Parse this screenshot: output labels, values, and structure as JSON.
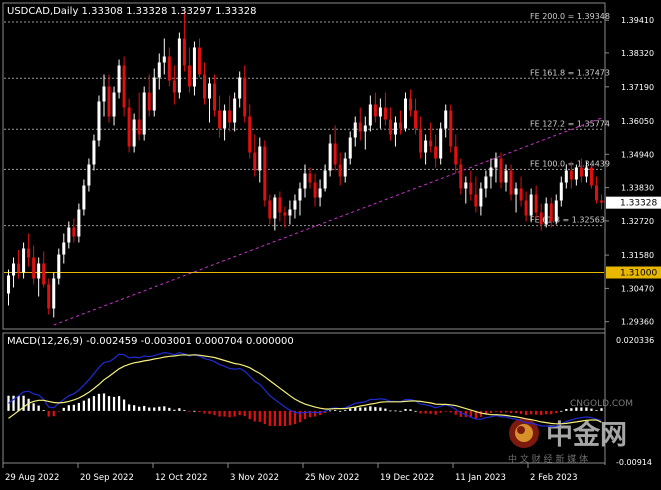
{
  "header": {
    "symbol_line": "USDCAD,Daily  1.33308 1.33328 1.33297 1.33328"
  },
  "macd_header": "MACD(12,26,9) -0.002459 -0.003001 0.000704 0.000000",
  "price_axis": {
    "ticks": [
      "1.39410",
      "1.38320",
      "1.37190",
      "1.36050",
      "1.34940",
      "1.33830",
      "1.32720",
      "1.31580",
      "1.30470",
      "1.29360"
    ],
    "current_price_tag": "1.33328",
    "level_tag": "1.31000"
  },
  "macd_axis": {
    "ticks": [
      "0.020336",
      "-0.00914"
    ]
  },
  "date_axis": {
    "ticks": [
      "29 Aug 2022",
      "20 Sep 2022",
      "12 Oct 2022",
      "3 Nov 2022",
      "25 Nov 2022",
      "19 Dec 2022",
      "11 Jan 2023",
      "2 Feb 2023"
    ]
  },
  "fib_levels": [
    {
      "label": "FE 200.0 = 1.39348",
      "value": 1.39348
    },
    {
      "label": "FE 161.8 = 1.37473",
      "value": 1.37473
    },
    {
      "label": "FE 127.2 = 1.35774",
      "value": 1.35774
    },
    {
      "label": "FE 100.0 = 1.34439",
      "value": 1.34439
    },
    {
      "label": "FE 61.8 = 1.32563",
      "value": 1.32563
    }
  ],
  "watermark": {
    "brand_cn": "中金网",
    "domain": "CNGOLD.COM",
    "tagline": "中 文 财 经 新 媒 体"
  },
  "colors": {
    "background": "#000000",
    "bull_candle": "#ffffff",
    "bear_candle": "#e01010",
    "fib_line": "#9a9a9a",
    "trendline": "#cc33cc",
    "level_line": "#e8b800",
    "macd_line": "#1f2bd6",
    "signal_line": "#f2f07a",
    "hist_up": "#ffffff",
    "hist_down": "#e01010"
  },
  "chart_data": {
    "type": "candlestick",
    "symbol": "USDCAD",
    "timeframe": "Daily",
    "ylim": [
      1.2915,
      1.3995
    ],
    "horizontal_level": 1.31,
    "last_price": 1.33328,
    "trendline": {
      "from": {
        "bar": 9,
        "price": 1.2925
      },
      "to": {
        "bar": 118,
        "price": 1.3615
      }
    },
    "candles": [
      [
        1.303,
        1.311,
        1.299,
        1.309
      ],
      [
        1.309,
        1.315,
        1.305,
        1.313
      ],
      [
        1.313,
        1.3175,
        1.308,
        1.31
      ],
      [
        1.31,
        1.32,
        1.308,
        1.318
      ],
      [
        1.318,
        1.323,
        1.312,
        1.315
      ],
      [
        1.315,
        1.319,
        1.306,
        1.308
      ],
      [
        1.308,
        1.315,
        1.302,
        1.313
      ],
      [
        1.313,
        1.317,
        1.305,
        1.306
      ],
      [
        1.306,
        1.308,
        1.296,
        1.298
      ],
      [
        1.298,
        1.31,
        1.295,
        1.308
      ],
      [
        1.308,
        1.318,
        1.306,
        1.316
      ],
      [
        1.316,
        1.323,
        1.313,
        1.32
      ],
      [
        1.32,
        1.327,
        1.318,
        1.325
      ],
      [
        1.325,
        1.328,
        1.32,
        1.322
      ],
      [
        1.322,
        1.333,
        1.32,
        1.331
      ],
      [
        1.331,
        1.341,
        1.329,
        1.339
      ],
      [
        1.339,
        1.348,
        1.337,
        1.346
      ],
      [
        1.346,
        1.356,
        1.344,
        1.354
      ],
      [
        1.354,
        1.369,
        1.352,
        1.367
      ],
      [
        1.367,
        1.376,
        1.362,
        1.372
      ],
      [
        1.372,
        1.376,
        1.36,
        1.362
      ],
      [
        1.362,
        1.372,
        1.359,
        1.37
      ],
      [
        1.37,
        1.381,
        1.368,
        1.379
      ],
      [
        1.379,
        1.382,
        1.362,
        1.365
      ],
      [
        1.365,
        1.368,
        1.35,
        1.352
      ],
      [
        1.352,
        1.363,
        1.35,
        1.361
      ],
      [
        1.361,
        1.37,
        1.354,
        1.356
      ],
      [
        1.356,
        1.372,
        1.354,
        1.37
      ],
      [
        1.37,
        1.376,
        1.362,
        1.364
      ],
      [
        1.364,
        1.378,
        1.362,
        1.375
      ],
      [
        1.375,
        1.383,
        1.371,
        1.38
      ],
      [
        1.38,
        1.388,
        1.376,
        1.382
      ],
      [
        1.382,
        1.385,
        1.372,
        1.374
      ],
      [
        1.374,
        1.379,
        1.366,
        1.37
      ],
      [
        1.37,
        1.39,
        1.368,
        1.388
      ],
      [
        1.388,
        1.397,
        1.377,
        1.379
      ],
      [
        1.379,
        1.385,
        1.37,
        1.372
      ],
      [
        1.372,
        1.387,
        1.369,
        1.385
      ],
      [
        1.385,
        1.388,
        1.375,
        1.376
      ],
      [
        1.376,
        1.38,
        1.366,
        1.368
      ],
      [
        1.368,
        1.375,
        1.36,
        1.373
      ],
      [
        1.373,
        1.376,
        1.362,
        1.364
      ],
      [
        1.364,
        1.369,
        1.355,
        1.358
      ],
      [
        1.358,
        1.366,
        1.354,
        1.364
      ],
      [
        1.364,
        1.369,
        1.357,
        1.36
      ],
      [
        1.36,
        1.37,
        1.357,
        1.368
      ],
      [
        1.368,
        1.377,
        1.365,
        1.375
      ],
      [
        1.375,
        1.379,
        1.36,
        1.362
      ],
      [
        1.362,
        1.366,
        1.348,
        1.35
      ],
      [
        1.35,
        1.356,
        1.342,
        1.344
      ],
      [
        1.344,
        1.355,
        1.34,
        1.352
      ],
      [
        1.352,
        1.354,
        1.332,
        1.334
      ],
      [
        1.334,
        1.336,
        1.326,
        1.328
      ],
      [
        1.328,
        1.336,
        1.324,
        1.335
      ],
      [
        1.335,
        1.337,
        1.327,
        1.33
      ],
      [
        1.33,
        1.332,
        1.325,
        1.329
      ],
      [
        1.329,
        1.334,
        1.326,
        1.331
      ],
      [
        1.331,
        1.336,
        1.328,
        1.334
      ],
      [
        1.334,
        1.34,
        1.329,
        1.338
      ],
      [
        1.338,
        1.346,
        1.335,
        1.343
      ],
      [
        1.343,
        1.345,
        1.338,
        1.34
      ],
      [
        1.34,
        1.343,
        1.332,
        1.335
      ],
      [
        1.335,
        1.341,
        1.332,
        1.338
      ],
      [
        1.338,
        1.346,
        1.337,
        1.344
      ],
      [
        1.344,
        1.356,
        1.342,
        1.353
      ],
      [
        1.353,
        1.359,
        1.344,
        1.346
      ],
      [
        1.346,
        1.35,
        1.339,
        1.342
      ],
      [
        1.342,
        1.35,
        1.34,
        1.348
      ],
      [
        1.348,
        1.357,
        1.346,
        1.355
      ],
      [
        1.355,
        1.362,
        1.352,
        1.36
      ],
      [
        1.36,
        1.365,
        1.354,
        1.357
      ],
      [
        1.357,
        1.362,
        1.351,
        1.359
      ],
      [
        1.359,
        1.369,
        1.357,
        1.366
      ],
      [
        1.366,
        1.37,
        1.36,
        1.362
      ],
      [
        1.362,
        1.368,
        1.358,
        1.365
      ],
      [
        1.365,
        1.37,
        1.359,
        1.361
      ],
      [
        1.361,
        1.365,
        1.354,
        1.356
      ],
      [
        1.356,
        1.362,
        1.352,
        1.36
      ],
      [
        1.36,
        1.364,
        1.356,
        1.358
      ],
      [
        1.358,
        1.37,
        1.357,
        1.368
      ],
      [
        1.368,
        1.371,
        1.362,
        1.364
      ],
      [
        1.364,
        1.368,
        1.356,
        1.358
      ],
      [
        1.358,
        1.362,
        1.348,
        1.35
      ],
      [
        1.35,
        1.356,
        1.346,
        1.354
      ],
      [
        1.354,
        1.36,
        1.35,
        1.352
      ],
      [
        1.352,
        1.356,
        1.345,
        1.348
      ],
      [
        1.348,
        1.36,
        1.346,
        1.358
      ],
      [
        1.358,
        1.366,
        1.355,
        1.364
      ],
      [
        1.364,
        1.366,
        1.35,
        1.352
      ],
      [
        1.352,
        1.356,
        1.343,
        1.346
      ],
      [
        1.346,
        1.348,
        1.336,
        1.338
      ],
      [
        1.338,
        1.342,
        1.333,
        1.34
      ],
      [
        1.34,
        1.344,
        1.334,
        1.336
      ],
      [
        1.336,
        1.342,
        1.33,
        1.332
      ],
      [
        1.332,
        1.34,
        1.329,
        1.338
      ],
      [
        1.338,
        1.344,
        1.335,
        1.342
      ],
      [
        1.342,
        1.348,
        1.338,
        1.345
      ],
      [
        1.345,
        1.35,
        1.34,
        1.348
      ],
      [
        1.348,
        1.35,
        1.338,
        1.34
      ],
      [
        1.34,
        1.346,
        1.337,
        1.344
      ],
      [
        1.344,
        1.346,
        1.334,
        1.336
      ],
      [
        1.336,
        1.34,
        1.33,
        1.338
      ],
      [
        1.338,
        1.342,
        1.332,
        1.334
      ],
      [
        1.334,
        1.337,
        1.327,
        1.329
      ],
      [
        1.329,
        1.338,
        1.327,
        1.336
      ],
      [
        1.336,
        1.339,
        1.328,
        1.33
      ],
      [
        1.33,
        1.333,
        1.324,
        1.326
      ],
      [
        1.326,
        1.335,
        1.325,
        1.333
      ],
      [
        1.333,
        1.335,
        1.325,
        1.327
      ],
      [
        1.327,
        1.336,
        1.326,
        1.334
      ],
      [
        1.334,
        1.342,
        1.332,
        1.34
      ],
      [
        1.34,
        1.346,
        1.338,
        1.344
      ],
      [
        1.344,
        1.347,
        1.338,
        1.341
      ],
      [
        1.341,
        1.346,
        1.339,
        1.345
      ],
      [
        1.345,
        1.348,
        1.34,
        1.342
      ],
      [
        1.342,
        1.347,
        1.34,
        1.345
      ],
      [
        1.345,
        1.347,
        1.338,
        1.339
      ],
      [
        1.339,
        1.342,
        1.333,
        1.334
      ],
      [
        1.334,
        1.336,
        1.331,
        1.3333
      ]
    ],
    "macd": [
      [
        0.002,
        -0.002,
        0.004
      ],
      [
        0.003,
        -0.001,
        0.004
      ],
      [
        0.004,
        0.0,
        0.004
      ],
      [
        0.005,
        0.001,
        0.004
      ],
      [
        0.0052,
        0.002,
        0.0032
      ],
      [
        0.0045,
        0.0025,
        0.002
      ],
      [
        0.0042,
        0.0028,
        0.0014
      ],
      [
        0.003,
        0.0028,
        0.0002
      ],
      [
        0.001,
        0.0025,
        -0.0015
      ],
      [
        0.0008,
        0.0022,
        -0.0014
      ],
      [
        0.002,
        0.0021,
        -0.0001
      ],
      [
        0.003,
        0.0022,
        0.0008
      ],
      [
        0.004,
        0.0025,
        0.0015
      ],
      [
        0.0045,
        0.0029,
        0.0016
      ],
      [
        0.0055,
        0.0034,
        0.0021
      ],
      [
        0.0068,
        0.0041,
        0.0027
      ],
      [
        0.0082,
        0.0049,
        0.0033
      ],
      [
        0.0098,
        0.0059,
        0.0039
      ],
      [
        0.0115,
        0.007,
        0.0045
      ],
      [
        0.0128,
        0.0082,
        0.0046
      ],
      [
        0.013,
        0.0091,
        0.0039
      ],
      [
        0.0138,
        0.0101,
        0.0037
      ],
      [
        0.015,
        0.0111,
        0.0039
      ],
      [
        0.0148,
        0.0118,
        0.003
      ],
      [
        0.014,
        0.0123,
        0.0017
      ],
      [
        0.0142,
        0.0127,
        0.0015
      ],
      [
        0.014,
        0.0129,
        0.0011
      ],
      [
        0.0145,
        0.0132,
        0.0013
      ],
      [
        0.0143,
        0.0134,
        0.0009
      ],
      [
        0.0146,
        0.0137,
        0.0009
      ],
      [
        0.015,
        0.0139,
        0.0011
      ],
      [
        0.0154,
        0.0142,
        0.0012
      ],
      [
        0.0152,
        0.0144,
        0.0008
      ],
      [
        0.0148,
        0.0145,
        0.0003
      ],
      [
        0.0154,
        0.0147,
        0.0007
      ],
      [
        0.015,
        0.0148,
        0.0002
      ],
      [
        0.0145,
        0.0147,
        -0.0002
      ],
      [
        0.0148,
        0.0148,
        0.0
      ],
      [
        0.0144,
        0.0147,
        -0.0003
      ],
      [
        0.0138,
        0.0145,
        -0.0007
      ],
      [
        0.0135,
        0.0143,
        -0.0008
      ],
      [
        0.013,
        0.0141,
        -0.0011
      ],
      [
        0.0122,
        0.0137,
        -0.0015
      ],
      [
        0.0118,
        0.0133,
        -0.0015
      ],
      [
        0.0112,
        0.0129,
        -0.0017
      ],
      [
        0.011,
        0.0125,
        -0.0015
      ],
      [
        0.0112,
        0.0123,
        -0.0011
      ],
      [
        0.0105,
        0.0119,
        -0.0014
      ],
      [
        0.0092,
        0.0114,
        -0.0022
      ],
      [
        0.0078,
        0.0106,
        -0.0028
      ],
      [
        0.007,
        0.0099,
        -0.0029
      ],
      [
        0.0055,
        0.009,
        -0.0035
      ],
      [
        0.004,
        0.008,
        -0.004
      ],
      [
        0.003,
        0.007,
        -0.004
      ],
      [
        0.002,
        0.006,
        -0.004
      ],
      [
        0.001,
        0.005,
        -0.004
      ],
      [
        0.0002,
        0.004,
        -0.0038
      ],
      [
        -0.0004,
        0.0031,
        -0.0035
      ],
      [
        -0.0006,
        0.0024,
        -0.003
      ],
      [
        -0.0004,
        0.0018,
        -0.0022
      ],
      [
        -0.0003,
        0.0014,
        -0.0017
      ],
      [
        -0.0005,
        0.001,
        -0.0015
      ],
      [
        -0.0004,
        0.0007,
        -0.0011
      ],
      [
        -0.0001,
        0.0005,
        -0.0006
      ],
      [
        0.0006,
        0.0005,
        0.0001
      ],
      [
        0.0008,
        0.0006,
        0.0002
      ],
      [
        0.0006,
        0.0006,
        0.0
      ],
      [
        0.0008,
        0.0006,
        0.0002
      ],
      [
        0.0014,
        0.0008,
        0.0006
      ],
      [
        0.002,
        0.001,
        0.001
      ],
      [
        0.0022,
        0.0013,
        0.0009
      ],
      [
        0.0024,
        0.0015,
        0.0009
      ],
      [
        0.003,
        0.0018,
        0.0012
      ],
      [
        0.003,
        0.002,
        0.001
      ],
      [
        0.0032,
        0.0023,
        0.0009
      ],
      [
        0.003,
        0.0024,
        0.0006
      ],
      [
        0.0025,
        0.0024,
        0.0001
      ],
      [
        0.0025,
        0.0024,
        0.0001
      ],
      [
        0.0024,
        0.0024,
        0.0
      ],
      [
        0.003,
        0.0025,
        0.0005
      ],
      [
        0.003,
        0.0026,
        0.0004
      ],
      [
        0.0026,
        0.0026,
        0.0
      ],
      [
        0.0018,
        0.0025,
        -0.0007
      ],
      [
        0.0016,
        0.0023,
        -0.0007
      ],
      [
        0.0013,
        0.0021,
        -0.0008
      ],
      [
        0.0008,
        0.0018,
        -0.001
      ],
      [
        0.0012,
        0.0017,
        -0.0005
      ],
      [
        0.0016,
        0.0017,
        -0.0001
      ],
      [
        0.0012,
        0.0016,
        -0.0004
      ],
      [
        0.0004,
        0.0014,
        -0.001
      ],
      [
        -0.0006,
        0.001,
        -0.0016
      ],
      [
        -0.001,
        0.0006,
        -0.0016
      ],
      [
        -0.0016,
        0.0002,
        -0.0018
      ],
      [
        -0.0022,
        -0.0002,
        -0.002
      ],
      [
        -0.0022,
        -0.0006,
        -0.0016
      ],
      [
        -0.0018,
        -0.0008,
        -0.001
      ],
      [
        -0.0016,
        -0.001,
        -0.0006
      ],
      [
        -0.0012,
        -0.001,
        -0.0002
      ],
      [
        -0.0016,
        -0.0011,
        -0.0005
      ],
      [
        -0.0016,
        -0.0012,
        -0.0004
      ],
      [
        -0.002,
        -0.0014,
        -0.0006
      ],
      [
        -0.0022,
        -0.0016,
        -0.0006
      ],
      [
        -0.0026,
        -0.0018,
        -0.0008
      ],
      [
        -0.0032,
        -0.0021,
        -0.0011
      ],
      [
        -0.0032,
        -0.0023,
        -0.0009
      ],
      [
        -0.0036,
        -0.0026,
        -0.001
      ],
      [
        -0.004,
        -0.0029,
        -0.0011
      ],
      [
        -0.004,
        -0.0031,
        -0.0009
      ],
      [
        -0.0042,
        -0.0033,
        -0.0009
      ],
      [
        -0.004,
        -0.0034,
        -0.0006
      ],
      [
        -0.0034,
        -0.0034,
        0.0
      ],
      [
        -0.0028,
        -0.0033,
        0.0005
      ],
      [
        -0.0024,
        -0.0031,
        0.0007
      ],
      [
        -0.002,
        -0.0029,
        0.0009
      ],
      [
        -0.0018,
        -0.0027,
        0.0009
      ],
      [
        -0.0016,
        -0.0025,
        0.0009
      ],
      [
        -0.0018,
        -0.0024,
        0.0006
      ],
      [
        -0.0022,
        -0.0024,
        0.0002
      ],
      [
        -0.0025,
        -0.003,
        0.0007
      ]
    ],
    "macd_ylim": [
      -0.0135,
      0.0203
    ]
  }
}
